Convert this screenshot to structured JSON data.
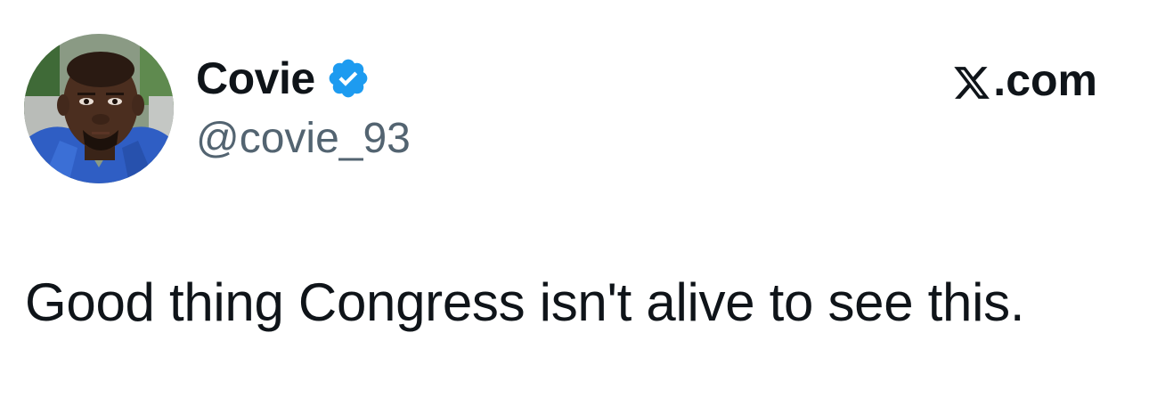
{
  "author": {
    "display_name": "Covie",
    "handle": "@covie_93",
    "verified": true,
    "avatar_icon": "profile-photo",
    "badge_icon": "verified-checkmark-icon",
    "badge_color": "#1d9bf0"
  },
  "site": {
    "logo_icon": "x-logo-icon",
    "domain_suffix": ".com"
  },
  "tweet": {
    "text": "Good thing Congress isn't alive to see this."
  },
  "colors": {
    "text_primary": "#0f1419",
    "text_secondary": "#536471",
    "background": "#ffffff"
  }
}
